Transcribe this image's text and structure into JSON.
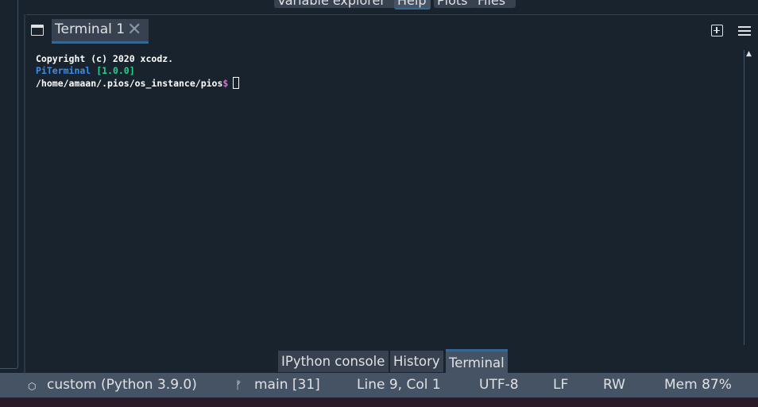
{
  "top_tabs": [
    "Variable explorer",
    "Help",
    "Plots",
    "Files"
  ],
  "pane": {
    "tab_label": "Terminal 1",
    "close_glyph": "✕"
  },
  "terminal": {
    "line1": "Copyright (c) 2020 xcodz.",
    "line2_name": "PiTerminal",
    "line2_version": "[1.0.0]",
    "line3_path": "/home/amaan/.pios/os_instance/pios",
    "line3_prompt": "$"
  },
  "bottom_tabs": [
    "IPython console",
    "History",
    "Terminal"
  ],
  "status": {
    "env": "custom (Python 3.9.0)",
    "branch": "main [31]",
    "position": "Line 9, Col 1",
    "encoding": "UTF-8",
    "eol": "LF",
    "mode": "RW",
    "memory": "Mem 87%"
  },
  "colors": {
    "background": "#19232d",
    "tab_bg": "#37414f",
    "accent": "#346792",
    "status_bg": "#455364"
  }
}
